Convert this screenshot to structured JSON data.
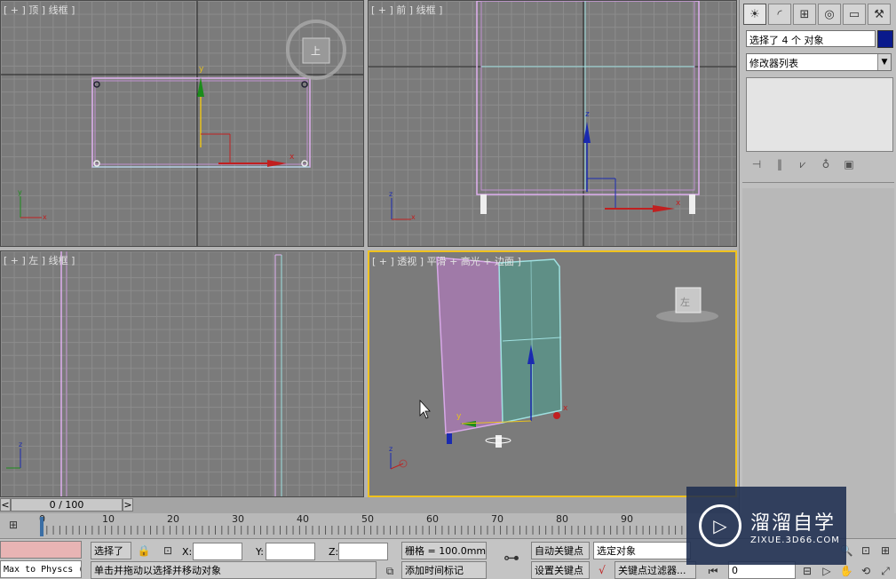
{
  "viewports": {
    "top": {
      "label": "[ + ] 顶 ] 线框 ]"
    },
    "front": {
      "label": "[ + ] 前 ] 线框 ]"
    },
    "left": {
      "label": "[ + ] 左 ] 线框 ]"
    },
    "perspective": {
      "label": "[ + ] 透视 ] 平滑 + 高光 + 边面 ]"
    }
  },
  "command_panel": {
    "tabs": [
      "create-icon",
      "modify-icon",
      "hierarchy-icon",
      "motion-icon",
      "display-icon",
      "utilities-icon"
    ],
    "selection_text": "选择了 4 个 对象",
    "object_color": "#0a1a8c",
    "modifier_list": "修改器列表"
  },
  "timeline": {
    "frame_display": "0 / 100",
    "prev": "<",
    "next": ">",
    "ruler_ticks": [
      "0",
      "10",
      "20",
      "30",
      "40",
      "50",
      "60",
      "70",
      "80",
      "90"
    ]
  },
  "status_bar": {
    "maxscript_text": "Max to Physcs (",
    "selected_label": "选择了",
    "x_label": "X:",
    "y_label": "Y:",
    "z_label": "Z:",
    "grid_text": "栅格 = 100.0mm",
    "auto_key": "自动关键点",
    "set_key": "设置关键点",
    "key_filter": "选定对象",
    "key_filters_btn": "关键点过滤器...",
    "prompt": "单击并拖动以选择并移动对象",
    "add_time_tag": "添加时间标记",
    "frame_field": "0"
  },
  "watermark": {
    "title": "溜溜自学",
    "subtitle": "ZIXUE.3D66.COM"
  }
}
